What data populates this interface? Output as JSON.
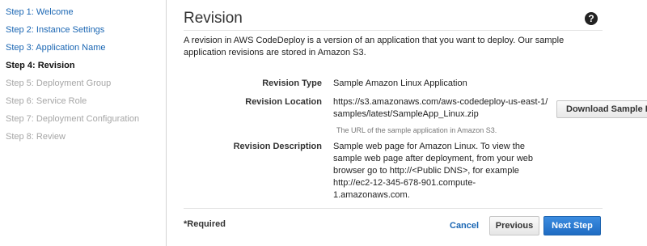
{
  "steps": [
    {
      "label": "Step 1: Welcome",
      "state": "done"
    },
    {
      "label": "Step 2: Instance Settings",
      "state": "done"
    },
    {
      "label": "Step 3: Application Name",
      "state": "done"
    },
    {
      "label": "Step 4: Revision",
      "state": "active"
    },
    {
      "label": "Step 5: Deployment Group",
      "state": "todo"
    },
    {
      "label": "Step 6: Service Role",
      "state": "todo"
    },
    {
      "label": "Step 7: Deployment Configuration",
      "state": "todo"
    },
    {
      "label": "Step 8: Review",
      "state": "todo"
    }
  ],
  "main": {
    "title": "Revision",
    "help_icon": "question-circle-icon",
    "help_glyph": "?",
    "intro": "A revision in AWS CodeDeploy is a version of an application that you want to deploy. Our sample application revisions are stored in Amazon S3."
  },
  "fields": {
    "revision_type_label": "Revision Type",
    "revision_type_value": "Sample Amazon Linux Application",
    "revision_location_label": "Revision Location",
    "revision_location_value": "https://s3.amazonaws.com/aws-codedeploy-us-east-1/samples/latest/SampleApp_Linux.zip",
    "revision_location_hint": "The URL of the sample application in Amazon S3.",
    "download_button": "Download Sample B",
    "revision_description_label": "Revision Description",
    "revision_description_value": "Sample web page for Amazon Linux. To view the sample web page after deployment, from your web browser go to http://<Public DNS>, for example http://ec2-12-345-678-901.compute-1.amazonaws.com."
  },
  "footer": {
    "required": "*Required",
    "cancel": "Cancel",
    "previous": "Previous",
    "next": "Next Step"
  },
  "colors": {
    "link": "#1a66b3",
    "primary_button": "#2a7bd3",
    "disabled_step": "#a6a6a6"
  }
}
